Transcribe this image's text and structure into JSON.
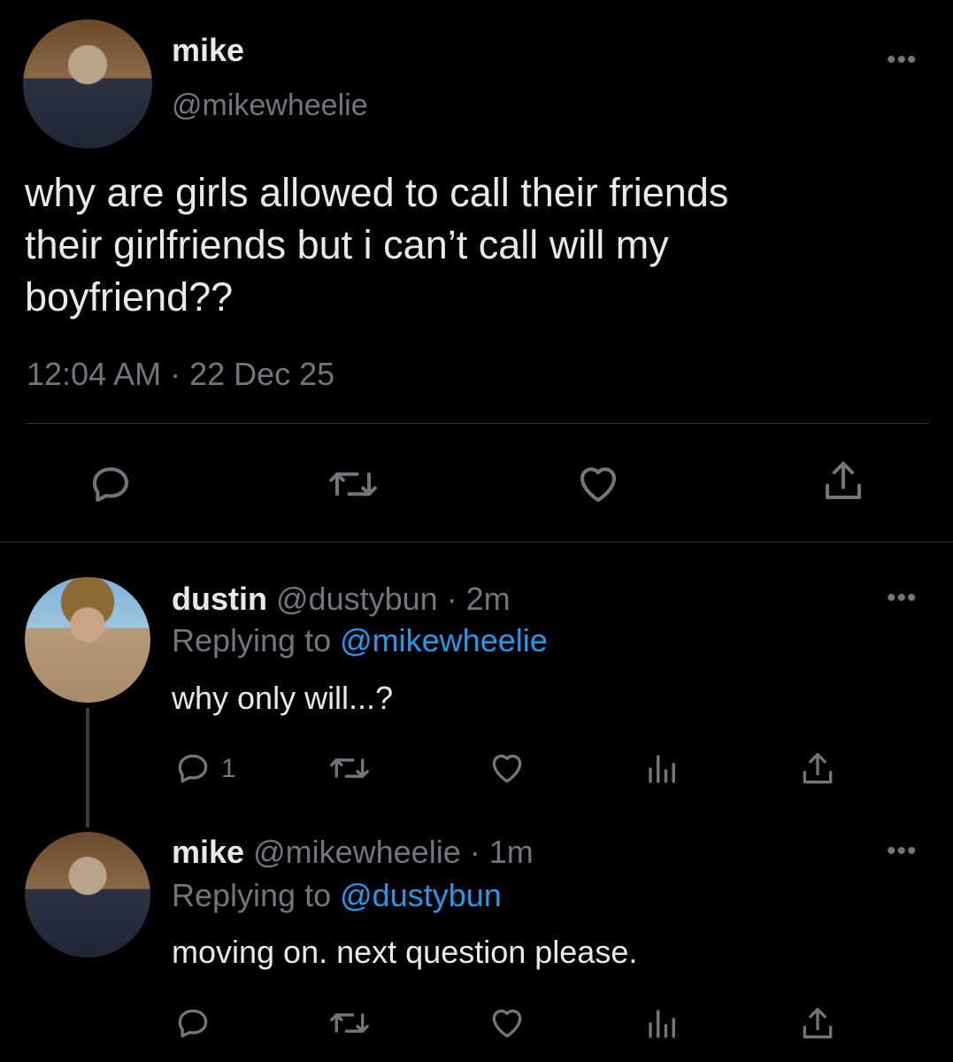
{
  "main_tweet": {
    "display_name": "mike",
    "handle": "@mikewheelie",
    "text_lines": [
      "why are girls allowed to call their friends",
      "their girlfriends but i can’t call will my",
      "boyfriend??"
    ],
    "timestamp": "12:04 AM · 22 Dec 25"
  },
  "reply1": {
    "display_name": "dustin",
    "handle": "@dustybun",
    "time": "· 2m",
    "replying_label": "Replying to",
    "replying_handle": "@mikewheelie",
    "text": "why only will...?",
    "reply_count": "1"
  },
  "reply2": {
    "display_name": "mike",
    "handle": "@mikewheelie",
    "time": "· 1m",
    "replying_label": "Replying to",
    "replying_handle": "@dustybun",
    "text": "moving on. next question please."
  },
  "more_glyph": "•••",
  "icons": {
    "reply": "reply-icon",
    "retweet": "retweet-icon",
    "like": "heart-icon",
    "share": "share-icon",
    "views": "views-icon"
  },
  "colors": {
    "background": "#000000",
    "text": "#e7e9ea",
    "muted": "#71767b",
    "link": "#1d9bf0",
    "divider": "#2f3336"
  }
}
